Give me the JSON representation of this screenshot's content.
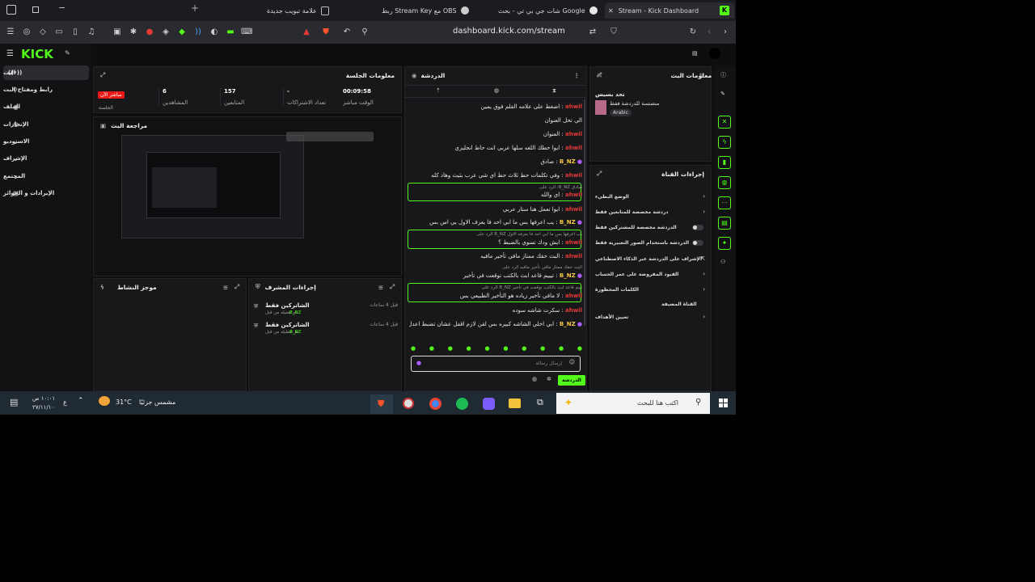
{
  "browser": {
    "tabs": [
      {
        "label": "Stream - Kick Dashboard",
        "active": true
      },
      {
        "label": "شات جي بي تي - بحث Google",
        "active": false
      },
      {
        "label": "ربط Stream Key مع OBS",
        "active": false
      },
      {
        "label": "علامة تبويب جديدة",
        "active": false
      }
    ],
    "url": "dashboard.kick.com/stream"
  },
  "nav": {
    "logo": "KICK",
    "items": [
      {
        "label": "البث",
        "active": true
      },
      {
        "label": "رابط ومفتاح البث"
      },
      {
        "label": "الملف"
      },
      {
        "label": "الإنجازات"
      },
      {
        "label": "الاستوديو"
      },
      {
        "label": "الإشراف"
      },
      {
        "label": "المجتمع"
      },
      {
        "label": "الإيرادات و الجوائز"
      }
    ]
  },
  "session": {
    "title": "معلومات الجلسة",
    "stats": [
      {
        "value": "00:09:58",
        "label": "الوقت مباشر"
      },
      {
        "value": "-",
        "label": "تعداد الاشتراكات"
      },
      {
        "value": "157",
        "label": "المتابعين"
      },
      {
        "value": "6",
        "label": "المشاهدين"
      }
    ],
    "live_badge": "مباشر الآن",
    "session_label": "الجلسة"
  },
  "preview": {
    "title": "مراجعة البث"
  },
  "activity": {
    "title": "موجز النشاط"
  },
  "modactions": {
    "title": "إجراءات المشرف",
    "items": [
      {
        "title": "الشاتركين فقط",
        "time": "قبل 4 ساعات",
        "user": "B_NZ",
        "sub": "تم تفعيله من قبل"
      },
      {
        "title": "الشاتركين فقط",
        "time": "قبل 4 ساعات",
        "user": "B_NZ",
        "sub": "تم تعطيله من قبل"
      }
    ]
  },
  "chat": {
    "title": "الدردشة",
    "messages": [
      {
        "user": "ahwil",
        "text": "اضغط على علامه القلم فوق يمين"
      },
      {
        "user": "",
        "text": "الي تحل العنوان"
      },
      {
        "user": "ahwil",
        "text": "العنوان"
      },
      {
        "user": "ahwil",
        "text": "ايوا حطك اللغه سلها عربي انت حاط انجليزي"
      },
      {
        "user": "B_NZ",
        "text": "صادق"
      },
      {
        "user": "ahwil",
        "text": "وفي تكلمات حط ثلاث حط اي شي عرب بثيث وهاد كله"
      },
      {
        "user": "ahwil",
        "text": "اي والله",
        "reply": "صادق B_NZ: الرد على"
      },
      {
        "user": "ahwil",
        "text": "ايوا تعمل هنا ستار عربي"
      },
      {
        "user": "B_NZ",
        "text": "يب اعرفها بس ما ابي احد فا يعرف الاول بي اس بس"
      },
      {
        "user": "ahwil",
        "text": "ايش ودك تسوي بالضبط ؟",
        "reply": "يب اعرفها بس ما ابي احد فا يعرفه الاول B_NZ الرد على"
      },
      {
        "user": "ahwil",
        "text": "البث حقك ممتاز مافي تأخير مافيه"
      },
      {
        "user": "B_NZ",
        "text": "تيييم قاعد ابث بالكتب توقعت في تأخير",
        "reply": "البث حقك ممتاز مافي تأخير مافيه الرد على"
      },
      {
        "user": "ahwil",
        "text": "لا مافي تأخير زياده هو التأخير الطبيعي بس",
        "reply": "تييم قاعد ابث بالكتب توقعت في تأخير B_NZ الرد على"
      },
      {
        "user": "ahwil",
        "text": "سكرت شاشه سوده"
      },
      {
        "user": "B_NZ",
        "text": "ابي اخلي الشاشه كبيره بس لقن لازم اقفل عشان تضبط اعدل المسلسه"
      }
    ],
    "input_placeholder": "إرسال رسالة",
    "send_label": "الدردشة"
  },
  "streaminfo": {
    "title": "معلومات البث",
    "stream_title": "تحد بسيس",
    "category": "منصتسة للدردشة فقط",
    "language": "Arabic"
  },
  "channel": {
    "title": "إجراءات القناة",
    "items": [
      {
        "label": "الوضع البطيء",
        "control": "arrow"
      },
      {
        "label": "دردشة مخصصة للمتابعين فقط",
        "control": "arrow"
      },
      {
        "label": "الدردشة مخصصة للمشتركين فقط",
        "control": "toggle"
      },
      {
        "label": "الدردشة باستخدام الصور التعبيرية فقط",
        "control": "toggle"
      },
      {
        "label": "الإشراف على الدردشة عبر الذكاء الاصطناعي",
        "control": "link"
      },
      {
        "label": "القيود المفروضة على عمر الحساب",
        "control": "arrow"
      },
      {
        "label": "الكلمات المحظورة",
        "control": "arrow"
      },
      {
        "label": "القناة المضيفة",
        "control": "none"
      },
      {
        "label": "تعيين الأهداف",
        "control": "arrow"
      }
    ]
  },
  "taskbar": {
    "search": "اكتب هنا للبحث",
    "weather": "مشمس جزئيًا",
    "temp": "31°C",
    "time": "١٠:٠١ ص",
    "date": "٢٧/١١/١٠",
    "lang": "ع"
  },
  "colors": {
    "accent": "#53fc18",
    "live": "#e91916"
  }
}
